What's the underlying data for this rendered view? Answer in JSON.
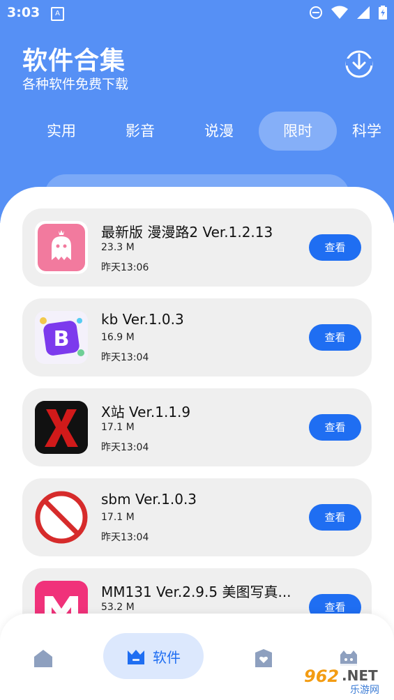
{
  "status_bar": {
    "time": "3:03",
    "notif_letter": "A"
  },
  "header": {
    "title": "软件合集",
    "subtitle": "各种软件免费下载"
  },
  "tabs": [
    {
      "label": "实用"
    },
    {
      "label": "影音"
    },
    {
      "label": "说漫"
    },
    {
      "label": "限时",
      "active": true
    },
    {
      "label": "科学"
    }
  ],
  "apps": [
    {
      "name": "最新版 漫漫路2 Ver.1.2.13",
      "size": "23.3 M",
      "date": "昨天13:06",
      "button": "查看",
      "icon": "ghost-app-icon"
    },
    {
      "name": "kb Ver.1.0.3",
      "size": "16.9 M",
      "date": "昨天13:04",
      "button": "查看",
      "icon": "b-app-icon"
    },
    {
      "name": "X站 Ver.1.1.9",
      "size": "17.1 M",
      "date": "昨天13:04",
      "button": "查看",
      "icon": "x-app-icon"
    },
    {
      "name": "sbm Ver.1.0.3",
      "size": "17.1 M",
      "date": "昨天13:04",
      "button": "查看",
      "icon": "no-sign-app-icon"
    },
    {
      "name": "MM131 Ver.2.9.5 美图写真...",
      "size": "53.2 M",
      "date": "",
      "button": "查看",
      "icon": "m-app-icon"
    }
  ],
  "bottom_nav": {
    "active_label": "软件"
  },
  "watermark": {
    "number": "962",
    "domain": ".NET",
    "cn": "乐游网"
  },
  "colors": {
    "brand": "#5690f5",
    "button": "#1f6ef2"
  }
}
